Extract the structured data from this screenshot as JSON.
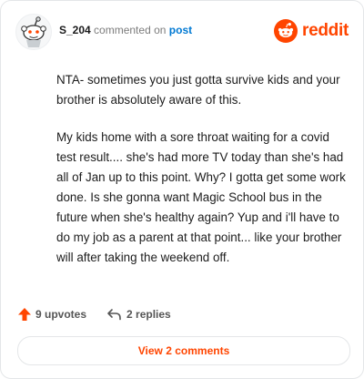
{
  "comment": {
    "username": "S_204",
    "connector_text": "commented on",
    "post_link": "post",
    "paragraphs": [
      "NTA- sometimes you just gotta survive kids and your brother is absolutely aware of this.",
      "My kids home with a sore throat waiting for a covid test result.... she's had more TV today than she's had all of Jan up to this point. Why? I gotta get some work done. Is she gonna want Magic School bus in the future when she's healthy again? Yup and i'll have to do my job as a parent at that point... like your brother will after taking the weekend off."
    ]
  },
  "brand": {
    "wordmark": "reddit",
    "color": "#ff4500"
  },
  "actions": {
    "upvotes_label": "9 upvotes",
    "replies_label": "2 replies"
  },
  "view_comments_label": "View 2 comments",
  "icons": {
    "avatar": "snoo-avatar-icon",
    "brand": "reddit-logo-icon",
    "upvote": "upvote-arrow-icon",
    "reply": "reply-arrow-icon"
  }
}
